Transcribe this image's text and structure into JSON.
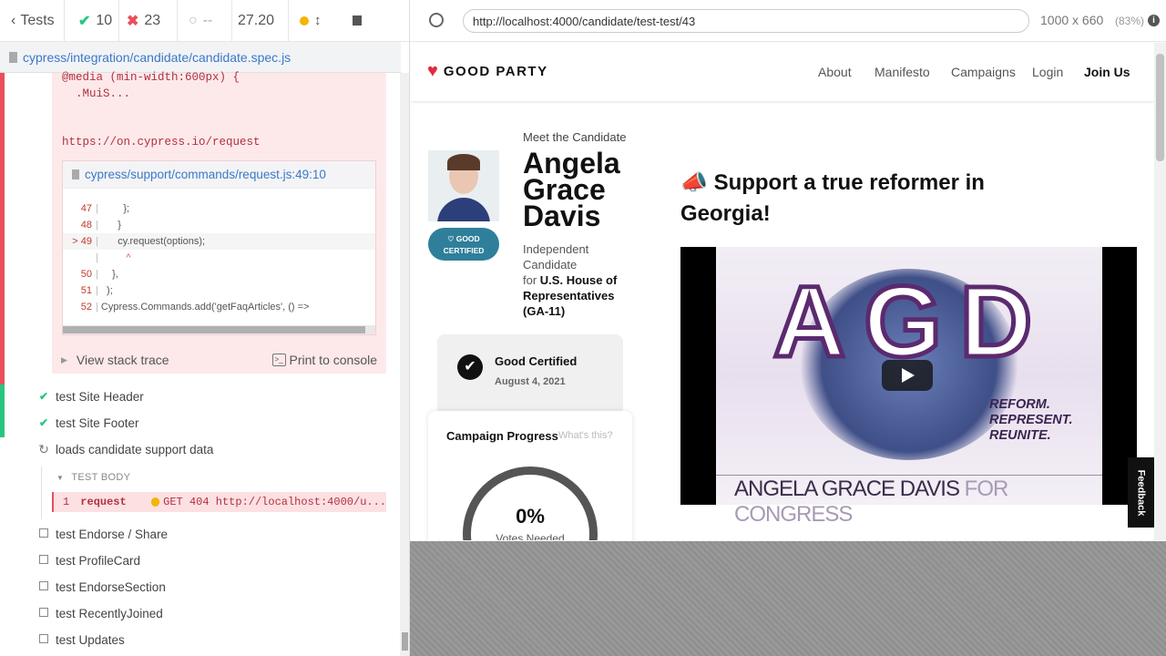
{
  "runner": {
    "tests_label": "Tests",
    "passed": "10",
    "failed": "23",
    "pending": "--",
    "duration": "27.20",
    "spec_path": "cypress/integration/candidate/candidate.spec.js"
  },
  "error": {
    "css_lines": "@media (min-width:600px) {\n  .MuiS...",
    "request_url": "https://on.cypress.io/request",
    "code_file": "cypress/support/commands/request.js:49:10",
    "code_lines": [
      {
        "num": "47",
        "text": "        };"
      },
      {
        "num": "48",
        "text": "      }"
      },
      {
        "num": "> 49",
        "text": "      cy.request(options);"
      },
      {
        "num": "",
        "text": "         ^"
      },
      {
        "num": "50",
        "text": "    },"
      },
      {
        "num": "51",
        "text": "  );"
      },
      {
        "num": "52",
        "text": "Cypress.Commands.add('getFaqArticles', () =>"
      }
    ],
    "view_stack": "View stack trace",
    "print_console": "Print to console"
  },
  "tests": [
    {
      "label": "test Site Header",
      "state": "passed"
    },
    {
      "label": "test Site Footer",
      "state": "passed"
    },
    {
      "label": "loads candidate support data",
      "state": "running"
    }
  ],
  "test_body": {
    "heading": "TEST BODY",
    "cmd_num": "1",
    "cmd_name": "request",
    "cmd_msg": "GET 404 http://localhost:4000/u..."
  },
  "pending_tests": [
    "test Endorse / Share",
    "test ProfileCard",
    "test EndorseSection",
    "test RecentlyJoined",
    "test Updates"
  ],
  "browser": {
    "url": "http://localhost:4000/candidate/test-test/43",
    "viewport_size": "1000 x 660",
    "scale": "(83%)"
  },
  "site": {
    "logo_text": "GOOD PARTY",
    "nav": [
      "About",
      "Manifesto",
      "Campaigns",
      "Login",
      "Join Us"
    ],
    "meet": "Meet the Candidate",
    "name_lines": [
      "Angela",
      "Grace",
      "Davis"
    ],
    "certified_badge": [
      "GOOD",
      "CERTIFIED"
    ],
    "party_lines": [
      "Independent",
      "Candidate"
    ],
    "for_label": "for",
    "office_lines": [
      "U.S. House of",
      "Representatives",
      "(GA-11)"
    ],
    "good_certified": "Good Certified",
    "cert_date": "August 4, 2021",
    "progress_title": "Campaign Progress",
    "whats_this": "What's this?",
    "progress_pct": "0%",
    "votes_needed": "Votes Needed",
    "headline_line1": "Support a true reformer in",
    "headline_line2": "Georgia!",
    "video_letters": [
      "A",
      "G",
      "D"
    ],
    "video_slogan": [
      "REFORM.",
      "REPRESENT.",
      "REUNITE."
    ],
    "video_caption_main": "ANGELA GRACE DAVIS",
    "video_caption_sub": "FOR CONGRESS",
    "feedback": "Feedback"
  },
  "colors": {
    "fail_red": "#e94f5b",
    "pass_green": "#27c680",
    "badge_teal": "#2f7f9a",
    "brand_red": "#e02b3b"
  }
}
